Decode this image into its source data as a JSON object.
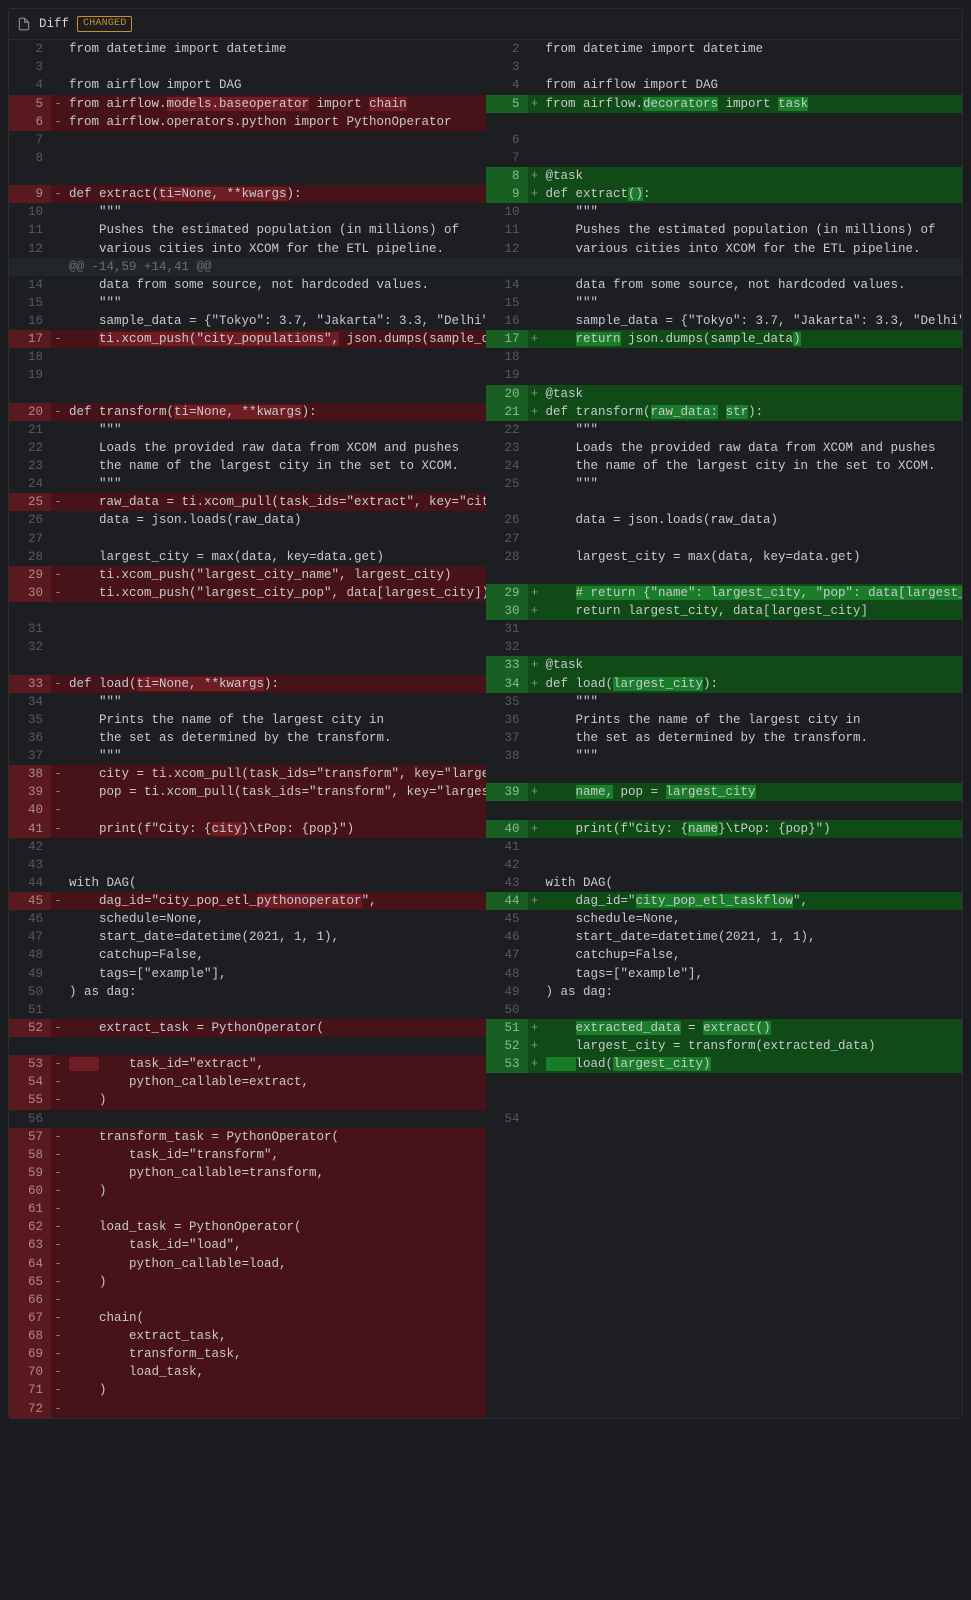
{
  "header": {
    "title": "Diff",
    "badge": "CHANGED"
  },
  "hunk_header": "@@ -14,59 +14,41 @@",
  "diff": [
    {
      "ln": "2",
      "l": "from datetime import datetime",
      "rn": "2",
      "r": "from datetime import datetime"
    },
    {
      "ln": "3",
      "l": "",
      "rn": "3",
      "r": ""
    },
    {
      "ln": "4",
      "l": "from airflow import DAG",
      "rn": "4",
      "r": "from airflow import DAG"
    },
    {
      "ln": "5",
      "l": "from airflow.<wd>models.baseoperator</wd> import <wd>chain</wd>",
      "lt": "del",
      "rn": "5",
      "r": "from airflow.<wa>decorators</wa> import <wa>task</wa>",
      "rt": "add"
    },
    {
      "ln": "6",
      "l": "from airflow.operators.python import PythonOperator",
      "lt": "del",
      "rn": "",
      "r": "",
      "rt": "blank"
    },
    {
      "ln": "7",
      "l": "",
      "rn": "6",
      "r": ""
    },
    {
      "ln": "8",
      "l": "",
      "rn": "7",
      "r": ""
    },
    {
      "ln": "",
      "l": "",
      "lt": "blank",
      "rn": "8",
      "r": "@task",
      "rt": "add"
    },
    {
      "ln": "9",
      "l": "def extract(<wd>ti=None, **kwargs</wd>):",
      "lt": "del",
      "rn": "9",
      "r": "def extract<wa>()</wa>:",
      "rt": "add"
    },
    {
      "ln": "10",
      "l": "    \"\"\"",
      "rn": "10",
      "r": "    \"\"\""
    },
    {
      "ln": "11",
      "l": "    Pushes the estimated population (in millions) of",
      "rn": "11",
      "r": "    Pushes the estimated population (in millions) of"
    },
    {
      "ln": "12",
      "l": "    various cities into XCOM for the ETL pipeline.",
      "rn": "12",
      "r": "    various cities into XCOM for the ETL pipeline."
    },
    {
      "hunk": true
    },
    {
      "ln": "14",
      "l": "    data from some source, not hardcoded values.",
      "rn": "14",
      "r": "    data from some source, not hardcoded values."
    },
    {
      "ln": "15",
      "l": "    \"\"\"",
      "rn": "15",
      "r": "    \"\"\""
    },
    {
      "ln": "16",
      "l": "    sample_data = {\"Tokyo\": 3.7, \"Jakarta\": 3.3, \"Delhi\"",
      "rn": "16",
      "r": "    sample_data = {\"Tokyo\": 3.7, \"Jakarta\": 3.3, \"Delhi\""
    },
    {
      "ln": "17",
      "l": "    <wd>ti.xcom_push(\"city_populations\",</wd> json.dumps(sample_d",
      "lt": "del",
      "rn": "17",
      "r": "    <wa>return</wa> json.dumps(sample_data<wa>)</wa>",
      "rt": "add"
    },
    {
      "ln": "18",
      "l": "",
      "rn": "18",
      "r": ""
    },
    {
      "ln": "19",
      "l": "",
      "rn": "19",
      "r": ""
    },
    {
      "ln": "",
      "l": "",
      "lt": "blank",
      "rn": "20",
      "r": "@task",
      "rt": "add"
    },
    {
      "ln": "20",
      "l": "def transform(<wd>ti=None, **kwargs</wd>):",
      "lt": "del",
      "rn": "21",
      "r": "def transform(<wa>raw_data:</wa> <wa>str</wa>):",
      "rt": "add"
    },
    {
      "ln": "21",
      "l": "    \"\"\"",
      "rn": "22",
      "r": "    \"\"\""
    },
    {
      "ln": "22",
      "l": "    Loads the provided raw data from XCOM and pushes",
      "rn": "23",
      "r": "    Loads the provided raw data from XCOM and pushes"
    },
    {
      "ln": "23",
      "l": "    the name of the largest city in the set to XCOM.",
      "rn": "24",
      "r": "    the name of the largest city in the set to XCOM."
    },
    {
      "ln": "24",
      "l": "    \"\"\"",
      "rn": "25",
      "r": "    \"\"\""
    },
    {
      "ln": "25",
      "l": "    raw_data = ti.xcom_pull(task_ids=\"extract\", key=\"cit",
      "lt": "del",
      "rn": "",
      "r": "",
      "rt": "blank"
    },
    {
      "ln": "26",
      "l": "    data = json.loads(raw_data)",
      "rn": "26",
      "r": "    data = json.loads(raw_data)"
    },
    {
      "ln": "27",
      "l": "",
      "rn": "27",
      "r": ""
    },
    {
      "ln": "28",
      "l": "    largest_city = max(data, key=data.get)",
      "rn": "28",
      "r": "    largest_city = max(data, key=data.get)"
    },
    {
      "ln": "29",
      "l": "    ti.xcom_push(\"largest_city_name\", largest_city)",
      "lt": "del",
      "rn": "",
      "r": "",
      "rt": "blank"
    },
    {
      "ln": "30",
      "l": "    ti.xcom_push(\"largest_city_pop\", data[largest_city])",
      "lt": "del",
      "rn": "29",
      "r": "    <wa># return {\"name\": largest_city, \"pop\": data[largest_</wa>",
      "rt": "add"
    },
    {
      "ln": "",
      "l": "",
      "lt": "blank",
      "rn": "30",
      "r": "    return largest_city, data[largest_city]",
      "rt": "add"
    },
    {
      "ln": "31",
      "l": "",
      "rn": "31",
      "r": ""
    },
    {
      "ln": "32",
      "l": "",
      "rn": "32",
      "r": ""
    },
    {
      "ln": "",
      "l": "",
      "lt": "blank",
      "rn": "33",
      "r": "@task",
      "rt": "add"
    },
    {
      "ln": "33",
      "l": "def load(<wd>ti=None, **kwargs</wd>):",
      "lt": "del",
      "rn": "34",
      "r": "def load(<wa>largest_city</wa>):",
      "rt": "add"
    },
    {
      "ln": "34",
      "l": "    \"\"\"",
      "rn": "35",
      "r": "    \"\"\""
    },
    {
      "ln": "35",
      "l": "    Prints the name of the largest city in",
      "rn": "36",
      "r": "    Prints the name of the largest city in"
    },
    {
      "ln": "36",
      "l": "    the set as determined by the transform.",
      "rn": "37",
      "r": "    the set as determined by the transform."
    },
    {
      "ln": "37",
      "l": "    \"\"\"",
      "rn": "38",
      "r": "    \"\"\""
    },
    {
      "ln": "38",
      "l": "    city = ti.xcom_pull(task_ids=\"transform\", key=\"large",
      "lt": "del",
      "rn": "",
      "r": "",
      "rt": "blank"
    },
    {
      "ln": "39",
      "l": "    pop = ti.xcom_pull(task_ids=\"transform\", key=\"larges",
      "lt": "del",
      "rn": "39",
      "r": "    <wa>name,</wa> pop = <wa>largest_city</wa>",
      "rt": "add"
    },
    {
      "ln": "40",
      "l": "",
      "lt": "del",
      "rn": "",
      "r": "",
      "rt": "blank"
    },
    {
      "ln": "41",
      "l": "    print(f\"City: {<wd>city</wd>}\\tPop: {pop}\")",
      "lt": "del",
      "rn": "40",
      "r": "    print(f\"City: {<wa>name</wa>}\\tPop: {pop}\")",
      "rt": "add"
    },
    {
      "ln": "42",
      "l": "",
      "rn": "41",
      "r": ""
    },
    {
      "ln": "43",
      "l": "",
      "rn": "42",
      "r": ""
    },
    {
      "ln": "44",
      "l": "with DAG(",
      "rn": "43",
      "r": "with DAG("
    },
    {
      "ln": "45",
      "l": "    dag_id=\"city_pop_etl_<wd>pythonoperator</wd>\",",
      "lt": "del",
      "rn": "44",
      "r": "    dag_id=\"<wa>city_pop_etl_taskflow</wa>\",",
      "rt": "add"
    },
    {
      "ln": "46",
      "l": "    schedule=None,",
      "rn": "45",
      "r": "    schedule=None,"
    },
    {
      "ln": "47",
      "l": "    start_date=datetime(2021, 1, 1),",
      "rn": "46",
      "r": "    start_date=datetime(2021, 1, 1),"
    },
    {
      "ln": "48",
      "l": "    catchup=False,",
      "rn": "47",
      "r": "    catchup=False,"
    },
    {
      "ln": "49",
      "l": "    tags=[\"example\"],",
      "rn": "48",
      "r": "    tags=[\"example\"],"
    },
    {
      "ln": "50",
      "l": ") as dag:",
      "rn": "49",
      "r": ") as dag:"
    },
    {
      "ln": "51",
      "l": "",
      "rn": "50",
      "r": ""
    },
    {
      "ln": "52",
      "l": "    extract_task = PythonOperator(",
      "lt": "del",
      "rn": "51",
      "r": "    <wa>extracted_data</wa> = <wa>extract()</wa>",
      "rt": "add"
    },
    {
      "ln": "",
      "l": "",
      "lt": "blank",
      "rn": "52",
      "r": "    largest_city = transform(extracted_data)",
      "rt": "add"
    },
    {
      "ln": "53",
      "l": "<wd>    </wd>    task_id=\"extract\",",
      "lt": "del",
      "rn": "53",
      "r": "<wa>    </wa>load(<wa>largest_city)</wa>",
      "rt": "add"
    },
    {
      "ln": "54",
      "l": "        python_callable=extract,",
      "lt": "del",
      "rn": "",
      "r": "",
      "rt": "blank"
    },
    {
      "ln": "55",
      "l": "    )",
      "lt": "del",
      "rn": "",
      "r": "",
      "rt": "blank"
    },
    {
      "ln": "56",
      "l": "",
      "rn": "54",
      "r": ""
    },
    {
      "ln": "57",
      "l": "    transform_task = PythonOperator(",
      "lt": "del",
      "rn": "",
      "r": "",
      "rt": "blank"
    },
    {
      "ln": "58",
      "l": "        task_id=\"transform\",",
      "lt": "del",
      "rn": "",
      "r": "",
      "rt": "blank"
    },
    {
      "ln": "59",
      "l": "        python_callable=transform,",
      "lt": "del",
      "rn": "",
      "r": "",
      "rt": "blank"
    },
    {
      "ln": "60",
      "l": "    )",
      "lt": "del",
      "rn": "",
      "r": "",
      "rt": "blank"
    },
    {
      "ln": "61",
      "l": "",
      "lt": "del",
      "rn": "",
      "r": "",
      "rt": "blank"
    },
    {
      "ln": "62",
      "l": "    load_task = PythonOperator(",
      "lt": "del",
      "rn": "",
      "r": "",
      "rt": "blank"
    },
    {
      "ln": "63",
      "l": "        task_id=\"load\",",
      "lt": "del",
      "rn": "",
      "r": "",
      "rt": "blank"
    },
    {
      "ln": "64",
      "l": "        python_callable=load,",
      "lt": "del",
      "rn": "",
      "r": "",
      "rt": "blank"
    },
    {
      "ln": "65",
      "l": "    )",
      "lt": "del",
      "rn": "",
      "r": "",
      "rt": "blank"
    },
    {
      "ln": "66",
      "l": "",
      "lt": "del",
      "rn": "",
      "r": "",
      "rt": "blank"
    },
    {
      "ln": "67",
      "l": "    chain(",
      "lt": "del",
      "rn": "",
      "r": "",
      "rt": "blank"
    },
    {
      "ln": "68",
      "l": "        extract_task,",
      "lt": "del",
      "rn": "",
      "r": "",
      "rt": "blank"
    },
    {
      "ln": "69",
      "l": "        transform_task,",
      "lt": "del",
      "rn": "",
      "r": "",
      "rt": "blank"
    },
    {
      "ln": "70",
      "l": "        load_task,",
      "lt": "del",
      "rn": "",
      "r": "",
      "rt": "blank"
    },
    {
      "ln": "71",
      "l": "    )",
      "lt": "del",
      "rn": "",
      "r": "",
      "rt": "blank"
    },
    {
      "ln": "72",
      "l": "",
      "lt": "del",
      "rn": "",
      "r": "",
      "rt": "blank"
    }
  ]
}
